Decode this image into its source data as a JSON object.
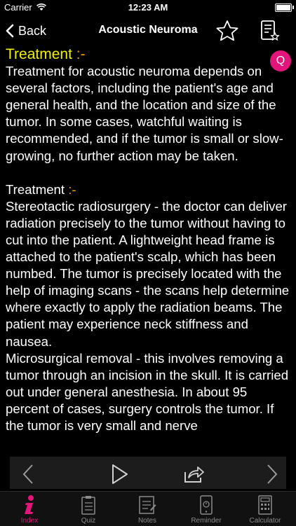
{
  "status": {
    "carrier": "Carrier",
    "time": "12:23 AM",
    "battery_level": 1.0
  },
  "nav": {
    "back_label": "Back",
    "title": "Acoustic Neuroma"
  },
  "content": {
    "q_button": "Q",
    "sections": [
      {
        "heading": "Treatment",
        "heading_suffix": " :-",
        "text": "Treatment for acoustic neuroma depends on several factors, including the patient's age and general health, and the location and size of the tumor. In some cases, watchful waiting is recommended, and if the tumor is small or slow-growing, no further action may be taken."
      },
      {
        "heading": "Treatment",
        "heading_suffix": " :-",
        "text": "Stereotactic radiosurgery - the doctor can deliver radiation precisely to the tumor without having to cut into the patient. A lightweight head frame is attached to the patient's scalp, which has been numbed. The tumor is precisely located with the help of imaging scans - the scans help determine where exactly to apply the radiation beams. The patient may experience neck stiffness and nausea.\nMicrosurgical removal - this involves removing a tumor through an incision in the skull. It is carried out under general anesthesia. In about 95 percent of cases, surgery controls the tumor. If the tumor is very small and nerve"
      }
    ]
  },
  "tabs": [
    {
      "label": "Index",
      "icon": "info-icon"
    },
    {
      "label": "Quiz",
      "icon": "quiz-clipboard-icon"
    },
    {
      "label": "Notes",
      "icon": "notes-icon"
    },
    {
      "label": "Reminder",
      "icon": "reminder-phone-icon"
    },
    {
      "label": "Calculator",
      "icon": "calculator-icon"
    }
  ],
  "colors": {
    "accent": "#e3157b",
    "heading": "#f0f000",
    "heading_suffix": "#f0a000",
    "background": "#000000"
  }
}
